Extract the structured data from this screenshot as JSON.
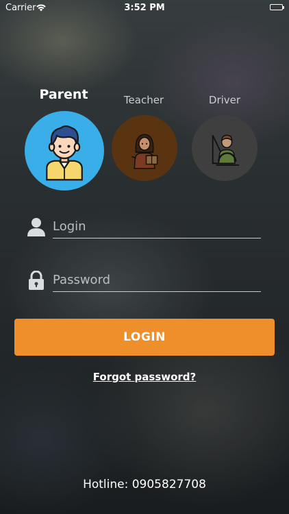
{
  "status_bar": {
    "carrier": "Carrier",
    "time": "3:52 PM"
  },
  "roles": [
    {
      "label": "Parent",
      "icon": "parent-icon",
      "selected": true,
      "color": "#3aaee8"
    },
    {
      "label": "Teacher",
      "icon": "teacher-icon",
      "selected": false,
      "color": "#5a3410"
    },
    {
      "label": "Driver",
      "icon": "driver-icon",
      "selected": false,
      "color": "#3f3f3f"
    }
  ],
  "form": {
    "login_placeholder": "Login",
    "login_value": "",
    "password_placeholder": "Password",
    "password_value": "",
    "submit_label": "LOGIN",
    "forgot_label": "Forgot password?"
  },
  "footer": {
    "hotline": "Hotline: 0905827708"
  },
  "colors": {
    "accent": "#ef8f2b",
    "selected_role": "#3aaee8"
  }
}
